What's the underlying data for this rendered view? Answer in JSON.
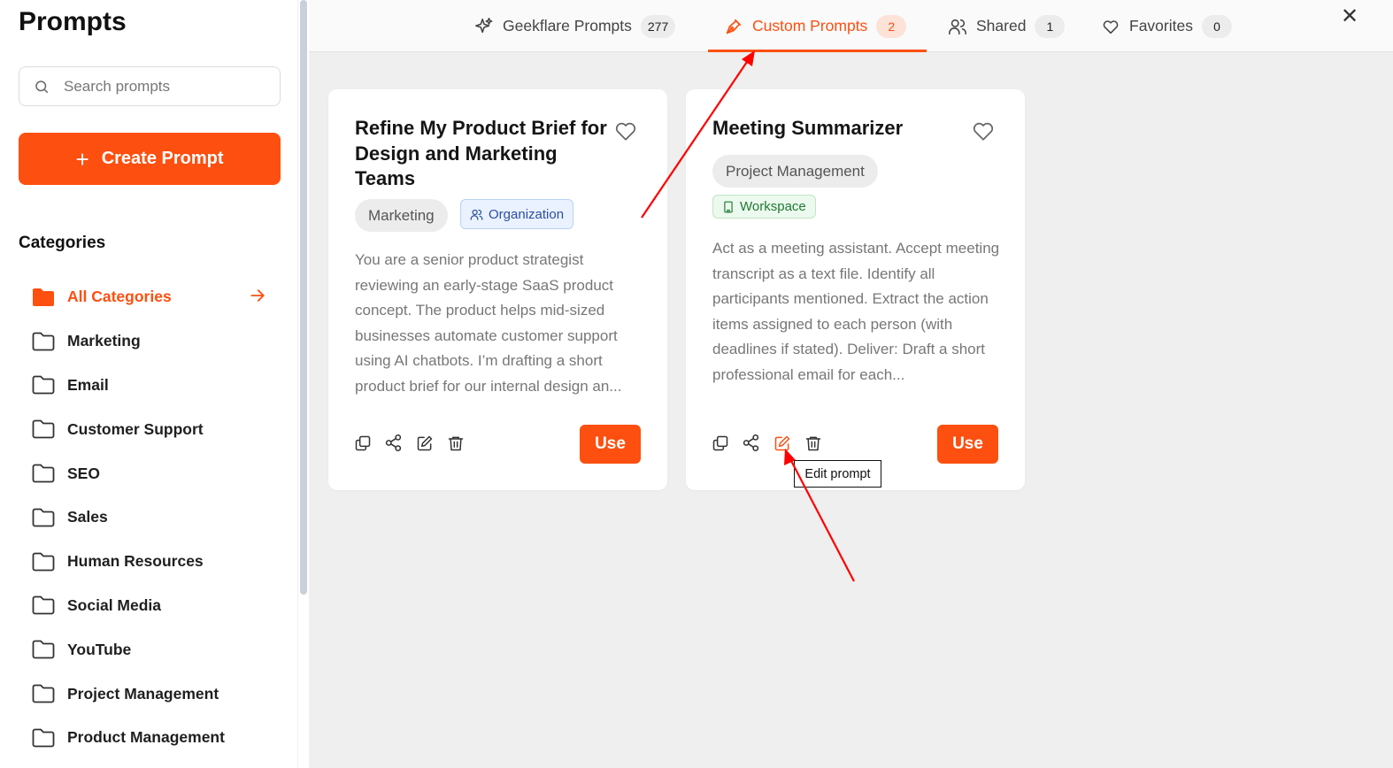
{
  "sidebar": {
    "title": "Prompts",
    "search_placeholder": "Search prompts",
    "create_label": "Create Prompt",
    "categories_heading": "Categories",
    "categories": [
      {
        "label": "All Categories",
        "active": true
      },
      {
        "label": "Marketing"
      },
      {
        "label": "Email"
      },
      {
        "label": "Customer Support"
      },
      {
        "label": "SEO"
      },
      {
        "label": "Sales"
      },
      {
        "label": "Human Resources"
      },
      {
        "label": "Social Media"
      },
      {
        "label": "YouTube"
      },
      {
        "label": "Project Management"
      },
      {
        "label": "Product Management"
      }
    ]
  },
  "tabs": [
    {
      "label": "Geekflare Prompts",
      "count": "277",
      "icon": "sparkle-icon"
    },
    {
      "label": "Custom Prompts",
      "count": "2",
      "icon": "pen-icon",
      "active": true
    },
    {
      "label": "Shared",
      "count": "1",
      "icon": "users-icon"
    },
    {
      "label": "Favorites",
      "count": "0",
      "icon": "heart-icon"
    }
  ],
  "cards": [
    {
      "title": "Refine My Product Brief for Design and Marketing Teams",
      "category": "Marketing",
      "visibility": "Organization",
      "description": "You are a senior product strategist reviewing an early-stage SaaS product concept. The product helps mid-sized businesses automate customer support using AI chatbots. I’m drafting a short product brief for our internal design an...",
      "use_label": "Use"
    },
    {
      "title": "Meeting Summarizer",
      "category": "Project Management",
      "visibility": "Workspace",
      "description": "Act as a meeting assistant. Accept meeting transcript as a text file. Identify all participants mentioned. Extract the action items assigned to each person (with deadlines if stated). Deliver: Draft a short professional email for each...",
      "use_label": "Use"
    }
  ],
  "tooltip": "Edit prompt",
  "colors": {
    "accent": "#fd4f10",
    "annotation_arrow": "#ff0000"
  }
}
